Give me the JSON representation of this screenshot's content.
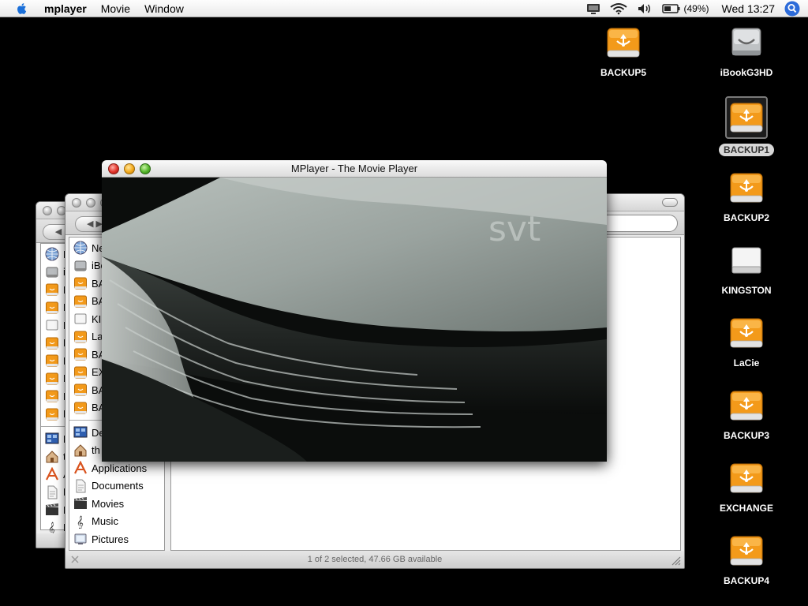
{
  "menubar": {
    "app_name": "mplayer",
    "items": [
      "Movie",
      "Window"
    ],
    "battery_percent": "(49%)",
    "clock": "Wed 13:27"
  },
  "desktop_icons": [
    {
      "label": "BACKUP5",
      "kind": "firewire-drive-icon"
    },
    {
      "label": "iBookG3HD",
      "kind": "hard-drive-icon"
    },
    {
      "label": "BACKUP1",
      "kind": "firewire-drive-icon",
      "selected": true
    },
    {
      "label": "BACKUP2",
      "kind": "firewire-drive-icon"
    },
    {
      "label": "KINGSTON",
      "kind": "usb-drive-icon"
    },
    {
      "label": "LaCie",
      "kind": "firewire-drive-icon"
    },
    {
      "label": "BACKUP3",
      "kind": "firewire-drive-icon"
    },
    {
      "label": "EXCHANGE",
      "kind": "firewire-drive-icon"
    },
    {
      "label": "BACKUP4",
      "kind": "firewire-drive-icon"
    }
  ],
  "mplayer": {
    "title": "MPlayer - The Movie Player",
    "watermark": "svt"
  },
  "finder_front": {
    "sidebar_devices": [
      {
        "label": "Ne",
        "icon": "network-icon"
      },
      {
        "label": "iBo",
        "icon": "hard-drive-icon"
      },
      {
        "label": "BA",
        "icon": "firewire-drive-icon"
      },
      {
        "label": "BA",
        "icon": "firewire-drive-icon"
      },
      {
        "label": "KI",
        "icon": "usb-drive-icon"
      },
      {
        "label": "La",
        "icon": "firewire-drive-icon"
      },
      {
        "label": "BA",
        "icon": "firewire-drive-icon"
      },
      {
        "label": "EX",
        "icon": "firewire-drive-icon"
      },
      {
        "label": "BA",
        "icon": "firewire-drive-icon"
      },
      {
        "label": "BA",
        "icon": "firewire-drive-icon"
      }
    ],
    "sidebar_places": [
      {
        "label": "De",
        "icon": "desktop-icon"
      },
      {
        "label": "th",
        "icon": "home-icon"
      },
      {
        "label": "Applications",
        "icon": "applications-icon"
      },
      {
        "label": "Documents",
        "icon": "documents-icon"
      },
      {
        "label": "Movies",
        "icon": "movies-icon"
      },
      {
        "label": "Music",
        "icon": "music-icon"
      },
      {
        "label": "Pictures",
        "icon": "pictures-icon"
      }
    ],
    "status": "1 of 2 selected, 47.66 GB available"
  },
  "finder_back": {
    "sidebar_devices": [
      {
        "label": "N",
        "icon": "network-icon"
      },
      {
        "label": "iI",
        "icon": "hard-drive-icon"
      },
      {
        "label": "B",
        "icon": "firewire-drive-icon"
      },
      {
        "label": "B",
        "icon": "firewire-drive-icon"
      },
      {
        "label": "K",
        "icon": "usb-drive-icon"
      },
      {
        "label": "L",
        "icon": "firewire-drive-icon"
      },
      {
        "label": "B",
        "icon": "firewire-drive-icon"
      },
      {
        "label": "E",
        "icon": "firewire-drive-icon"
      },
      {
        "label": "B",
        "icon": "firewire-drive-icon"
      },
      {
        "label": "B",
        "icon": "firewire-drive-icon"
      }
    ],
    "sidebar_places": [
      {
        "label": "D",
        "icon": "desktop-icon"
      },
      {
        "label": "t",
        "icon": "home-icon"
      },
      {
        "label": "A",
        "icon": "applications-icon"
      },
      {
        "label": "D",
        "icon": "documents-icon"
      },
      {
        "label": "M",
        "icon": "movies-icon"
      },
      {
        "label": "M",
        "icon": "music-icon"
      },
      {
        "label": "P",
        "icon": "pictures-icon"
      }
    ]
  },
  "colors": {
    "desktop": "#000000",
    "firewire_orange": "#f39a1a",
    "selection_label": "#d7d7d7"
  }
}
